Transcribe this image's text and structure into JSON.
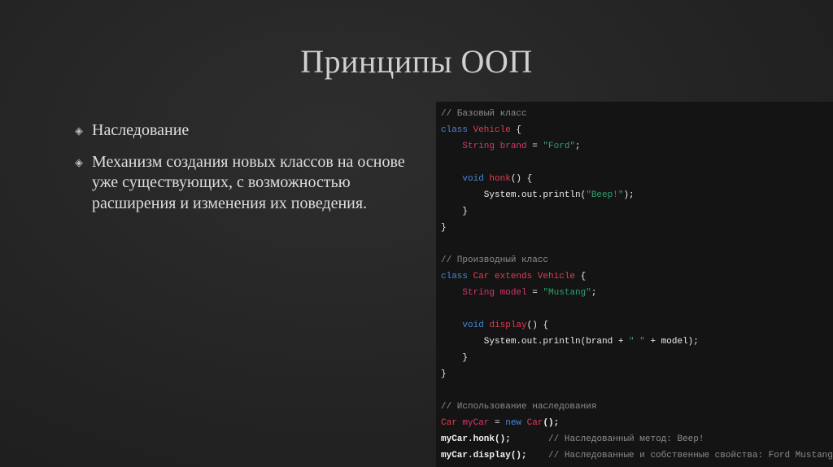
{
  "slide": {
    "title": "Принципы ООП",
    "bullets": [
      {
        "icon": "diamond-bullet-icon",
        "text": "Наследование"
      },
      {
        "icon": "diamond-bullet-icon",
        "text": "Механизм создания новых классов на основе уже существующих, с возможностью расширения и изменения их поведения."
      }
    ]
  },
  "code": {
    "colors": {
      "comment": "#8c8c8c",
      "keyword": "#4a86d6",
      "class": "#e23c52",
      "type": "#d6366e",
      "string": "#2fa070",
      "plain": "#ececec",
      "background": "#141414"
    },
    "lines": [
      [
        [
          "comment",
          "// Базовый класс"
        ]
      ],
      [
        [
          "keyword",
          "class "
        ],
        [
          "class",
          "Vehicle"
        ],
        [
          "plain",
          " {"
        ]
      ],
      [
        [
          "plain",
          "    "
        ],
        [
          "type",
          "String brand"
        ],
        [
          "plain",
          " = "
        ],
        [
          "string",
          "\"Ford\""
        ],
        [
          "plain",
          ";"
        ]
      ],
      [],
      [
        [
          "plain",
          "    "
        ],
        [
          "keyword",
          "void "
        ],
        [
          "class",
          "honk"
        ],
        [
          "plain",
          "() {"
        ]
      ],
      [
        [
          "plain",
          "        System.out.println("
        ],
        [
          "string",
          "\"Beep!\""
        ],
        [
          "plain",
          ");"
        ]
      ],
      [
        [
          "plain",
          "    }"
        ]
      ],
      [
        [
          "plain",
          "}"
        ]
      ],
      [],
      [
        [
          "comment",
          "// Производный класс"
        ]
      ],
      [
        [
          "keyword",
          "class "
        ],
        [
          "class",
          "Car extends Vehicle"
        ],
        [
          "plain",
          " {"
        ]
      ],
      [
        [
          "plain",
          "    "
        ],
        [
          "type",
          "String model"
        ],
        [
          "plain",
          " = "
        ],
        [
          "string",
          "\"Mustang\""
        ],
        [
          "plain",
          ";"
        ]
      ],
      [],
      [
        [
          "plain",
          "    "
        ],
        [
          "keyword",
          "void "
        ],
        [
          "class",
          "display"
        ],
        [
          "plain",
          "() {"
        ]
      ],
      [
        [
          "plain",
          "        System.out.println(brand + "
        ],
        [
          "string",
          "\" \""
        ],
        [
          "plain",
          " + model);"
        ]
      ],
      [
        [
          "plain",
          "    }"
        ]
      ],
      [
        [
          "plain",
          "}"
        ]
      ],
      [],
      [
        [
          "comment",
          "// Использование наследования"
        ]
      ],
      [
        [
          "class",
          "Car "
        ],
        [
          "type",
          "myCar"
        ],
        [
          "plain",
          " = "
        ],
        [
          "keyword",
          "new "
        ],
        [
          "class",
          "Car"
        ],
        [
          "bold",
          "();"
        ]
      ],
      [
        [
          "bold",
          "myCar.honk();"
        ],
        [
          "plain",
          "       "
        ],
        [
          "comment",
          "// Наследованный метод: Beep!"
        ]
      ],
      [
        [
          "bold",
          "myCar.display();"
        ],
        [
          "plain",
          "    "
        ],
        [
          "comment",
          "// Наследованные и собственные свойства: Ford Mustang"
        ]
      ]
    ]
  }
}
